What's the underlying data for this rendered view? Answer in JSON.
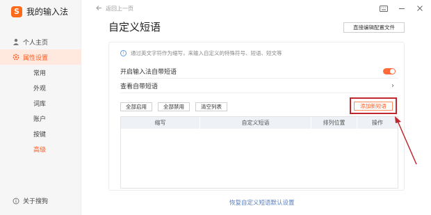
{
  "app": {
    "name": "我的输入法"
  },
  "sidebar": {
    "items": [
      {
        "label": "个人主页"
      },
      {
        "label": "属性设置"
      }
    ],
    "sub_items": [
      {
        "label": "常用"
      },
      {
        "label": "外观"
      },
      {
        "label": "词库"
      },
      {
        "label": "账户"
      },
      {
        "label": "按键"
      },
      {
        "label": "高级"
      }
    ],
    "about": "关于搜狗"
  },
  "topbar": {
    "back_label": "返回上一页"
  },
  "page": {
    "title": "自定义短语",
    "direct_edit": "直接编辑配置文件",
    "info": "通过英文字符作为缩写，来输入自定义的特殊符号、短语、短文等",
    "enable_builtin": "开启输入法自带短语",
    "view_builtin": "查看自带短语",
    "buttons": {
      "enable_all": "全部启用",
      "disable_all": "全部禁用",
      "clear_list": "清空列表",
      "add": "添加新短语"
    },
    "table_headers": [
      "缩写",
      "自定义短语",
      "排列位置",
      "操作"
    ],
    "restore": "恢复自定义短语默认设置"
  },
  "colors": {
    "accent": "#ff5a1f",
    "highlight_box": "#c0262d"
  }
}
